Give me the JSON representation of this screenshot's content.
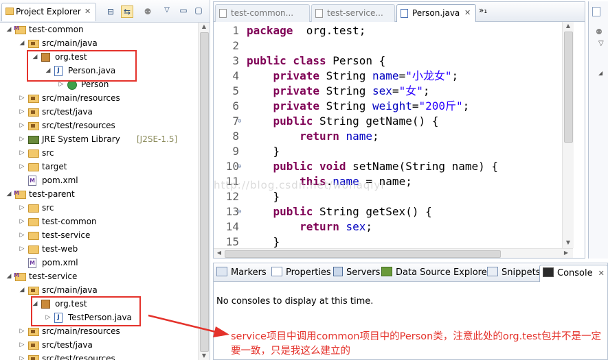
{
  "project_explorer": {
    "tab_title": "Project Explorer",
    "tab_close": "✕",
    "tree": [
      {
        "indent": 0,
        "arrow": "◢",
        "icon": "proj",
        "label": "test-common"
      },
      {
        "indent": 1,
        "arrow": "◢",
        "icon": "srcfolder",
        "label": "src/main/java"
      },
      {
        "indent": 2,
        "arrow": "◢",
        "icon": "pkg",
        "label": "org.test"
      },
      {
        "indent": 3,
        "arrow": "◢",
        "icon": "java",
        "label": "Person.java"
      },
      {
        "indent": 4,
        "arrow": "▷",
        "icon": "class",
        "label": "Person"
      },
      {
        "indent": 1,
        "arrow": "▷",
        "icon": "srcfolder",
        "label": "src/main/resources"
      },
      {
        "indent": 1,
        "arrow": "▷",
        "icon": "srcfolder",
        "label": "src/test/java"
      },
      {
        "indent": 1,
        "arrow": "▷",
        "icon": "srcfolder",
        "label": "src/test/resources"
      },
      {
        "indent": 1,
        "arrow": "▷",
        "icon": "lib",
        "label": "JRE System Library",
        "decoration": "[J2SE-1.5]"
      },
      {
        "indent": 1,
        "arrow": "▷",
        "icon": "folder",
        "label": "src"
      },
      {
        "indent": 1,
        "arrow": "▷",
        "icon": "folder",
        "label": "target"
      },
      {
        "indent": 1,
        "arrow": "",
        "icon": "xml",
        "label": "pom.xml"
      },
      {
        "indent": 0,
        "arrow": "◢",
        "icon": "proj",
        "label": "test-parent"
      },
      {
        "indent": 1,
        "arrow": "▷",
        "icon": "folder",
        "label": "src"
      },
      {
        "indent": 1,
        "arrow": "▷",
        "icon": "folder",
        "label": "test-common"
      },
      {
        "indent": 1,
        "arrow": "▷",
        "icon": "folder",
        "label": "test-service"
      },
      {
        "indent": 1,
        "arrow": "▷",
        "icon": "folder",
        "label": "test-web"
      },
      {
        "indent": 1,
        "arrow": "",
        "icon": "xml",
        "label": "pom.xml"
      },
      {
        "indent": 0,
        "arrow": "◢",
        "icon": "proj",
        "label": "test-service"
      },
      {
        "indent": 1,
        "arrow": "◢",
        "icon": "srcfolder",
        "label": "src/main/java"
      },
      {
        "indent": 2,
        "arrow": "◢",
        "icon": "pkg",
        "label": "org.test"
      },
      {
        "indent": 3,
        "arrow": "▷",
        "icon": "java",
        "label": "TestPerson.java"
      },
      {
        "indent": 1,
        "arrow": "▷",
        "icon": "srcfolder",
        "label": "src/main/resources"
      },
      {
        "indent": 1,
        "arrow": "▷",
        "icon": "srcfolder",
        "label": "src/test/java"
      },
      {
        "indent": 1,
        "arrow": "▷",
        "icon": "srcfolder",
        "label": "src/test/resources"
      }
    ]
  },
  "editor": {
    "tabs": [
      {
        "label": "test-common...",
        "active": false,
        "close": ""
      },
      {
        "label": "test-service...",
        "active": false,
        "close": ""
      },
      {
        "label": "Person.java",
        "active": true,
        "close": "✕"
      }
    ],
    "overflow": "»₁",
    "lines": [
      {
        "n": "1",
        "fold": "",
        "segs": [
          [
            "kw",
            "package"
          ],
          [
            "",
            "  org.test;"
          ]
        ]
      },
      {
        "n": "2",
        "fold": "",
        "segs": []
      },
      {
        "n": "3",
        "fold": "",
        "segs": [
          [
            "kw",
            "public class"
          ],
          [
            "",
            " Person {"
          ]
        ]
      },
      {
        "n": "4",
        "fold": "",
        "segs": [
          [
            "",
            "    "
          ],
          [
            "kw",
            "private"
          ],
          [
            "",
            " String "
          ],
          [
            "fld",
            "name"
          ],
          [
            "",
            "="
          ],
          [
            "str",
            "\"小龙女\""
          ],
          [
            "",
            ";"
          ]
        ]
      },
      {
        "n": "5",
        "fold": "",
        "segs": [
          [
            "",
            "    "
          ],
          [
            "kw",
            "private"
          ],
          [
            "",
            " String "
          ],
          [
            "fld",
            "sex"
          ],
          [
            "",
            "="
          ],
          [
            "str",
            "\"女\""
          ],
          [
            "",
            ";"
          ]
        ]
      },
      {
        "n": "6",
        "fold": "",
        "segs": [
          [
            "",
            "    "
          ],
          [
            "kw",
            "private"
          ],
          [
            "",
            " String "
          ],
          [
            "fld",
            "weight"
          ],
          [
            "",
            "="
          ],
          [
            "str",
            "\"200斤\""
          ],
          [
            "",
            ";"
          ]
        ]
      },
      {
        "n": "7",
        "fold": "⊖",
        "segs": [
          [
            "",
            "    "
          ],
          [
            "kw",
            "public"
          ],
          [
            "",
            " String getName() {"
          ]
        ]
      },
      {
        "n": "8",
        "fold": "",
        "segs": [
          [
            "",
            "        "
          ],
          [
            "kw",
            "return"
          ],
          [
            "",
            " "
          ],
          [
            "fld",
            "name"
          ],
          [
            "",
            ";"
          ]
        ]
      },
      {
        "n": "9",
        "fold": "",
        "segs": [
          [
            "",
            "    }"
          ]
        ]
      },
      {
        "n": "10",
        "fold": "⊖",
        "segs": [
          [
            "",
            "    "
          ],
          [
            "kw",
            "public void"
          ],
          [
            "",
            " setName(String name) {"
          ]
        ]
      },
      {
        "n": "11",
        "fold": "",
        "segs": [
          [
            "",
            "        "
          ],
          [
            "kw",
            "this"
          ],
          [
            "",
            "."
          ],
          [
            "fld",
            "name"
          ],
          [
            "",
            " = name;"
          ]
        ]
      },
      {
        "n": "12",
        "fold": "",
        "segs": [
          [
            "",
            "    }"
          ]
        ]
      },
      {
        "n": "13",
        "fold": "⊖",
        "segs": [
          [
            "",
            "    "
          ],
          [
            "kw",
            "public"
          ],
          [
            "",
            " String getSex() {"
          ]
        ]
      },
      {
        "n": "14",
        "fold": "",
        "segs": [
          [
            "",
            "        "
          ],
          [
            "kw",
            "return"
          ],
          [
            "",
            " "
          ],
          [
            "fld",
            "sex"
          ],
          [
            "",
            ";"
          ]
        ]
      },
      {
        "n": "15",
        "fold": "",
        "segs": [
          [
            "",
            "    }"
          ]
        ]
      }
    ],
    "watermark": "http://blog.csdn.net/wohaqiyi"
  },
  "console": {
    "tabs": [
      {
        "label": "Markers"
      },
      {
        "label": "Properties"
      },
      {
        "label": "Servers"
      },
      {
        "label": "Data Source Explorer"
      },
      {
        "label": "Snippets"
      },
      {
        "label": "Console",
        "active": true,
        "close": "✕"
      }
    ],
    "message": "No consoles to display at this time."
  },
  "annotation": {
    "text": "service项目中调用common项目中的Person类，注意此处的org.test包并不是一定要一致，只是我这么建立的"
  },
  "colors": {
    "annotation_red": "#e4322b",
    "keyword": "#7f0055",
    "field": "#0000c0",
    "string": "#2a00ff"
  }
}
